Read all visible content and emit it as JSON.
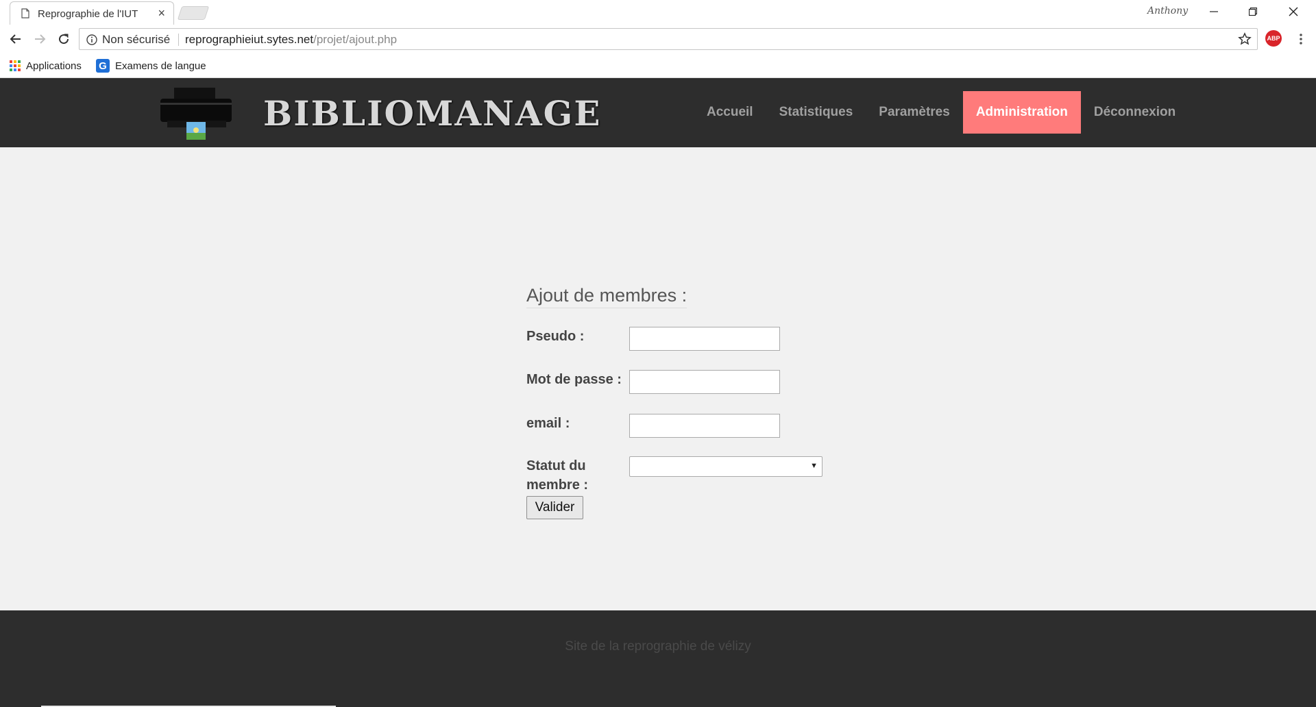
{
  "browser": {
    "tab_title": "Reprographie de l'IUT",
    "tab_close": "×",
    "profile": "Anthony",
    "security": "Non sécurisé",
    "url_host": "reprographieiut.sytes.net",
    "url_path": "/projet/ajout.php",
    "abp": "ABP",
    "bookmarks": [
      {
        "label": "Applications",
        "icon": "apps-grid-icon"
      },
      {
        "label": "Examens de langue",
        "icon": "g-icon"
      }
    ],
    "g_letter": "G"
  },
  "site": {
    "brand": "BIBLIOMANAGE",
    "nav": [
      {
        "label": "Accueil"
      },
      {
        "label": "Statistiques"
      },
      {
        "label": "Paramètres"
      },
      {
        "label": "Administration"
      },
      {
        "label": "Déconnexion"
      }
    ],
    "accent_color": "#ff7b7b",
    "header_bg": "#2d2d2d"
  },
  "form": {
    "title": "Ajout de membres :",
    "pseudo_label": "Pseudo :",
    "pseudo_value": "",
    "password_label": "Mot de passe :",
    "password_value": "",
    "email_label": "email :",
    "email_value": "",
    "status_label": "Statut du membre :",
    "status_selected": "",
    "submit_label": "Valider"
  },
  "footer": {
    "text": "Site de la reprographie de vélizy"
  }
}
